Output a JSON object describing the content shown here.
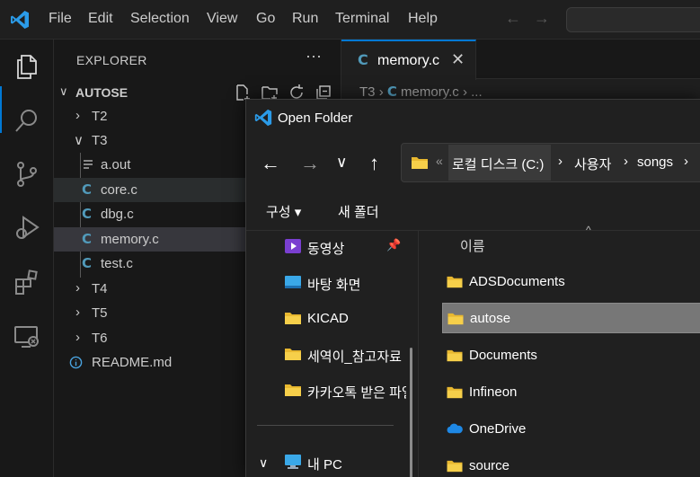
{
  "menu": [
    "File",
    "Edit",
    "Selection",
    "View",
    "Go",
    "Run",
    "Terminal",
    "Help"
  ],
  "colors": {
    "accent": "#0078d4",
    "c_icon": "#519aba",
    "folder": "#f0c040"
  },
  "explorer": {
    "title": "EXPLORER",
    "folder": "AUTOSE",
    "items": [
      {
        "label": "T2",
        "type": "folder",
        "expanded": false
      },
      {
        "label": "T3",
        "type": "folder",
        "expanded": true
      },
      {
        "label": "a.out",
        "type": "file",
        "icon": "lines-icon"
      },
      {
        "label": "core.c",
        "type": "c-file",
        "icon": "C"
      },
      {
        "label": "dbg.c",
        "type": "c-file",
        "icon": "C"
      },
      {
        "label": "memory.c",
        "type": "c-file",
        "icon": "C"
      },
      {
        "label": "test.c",
        "type": "c-file",
        "icon": "C"
      },
      {
        "label": "T4",
        "type": "folder",
        "expanded": false
      },
      {
        "label": "T5",
        "type": "folder",
        "expanded": false
      },
      {
        "label": "T6",
        "type": "folder",
        "expanded": false
      },
      {
        "label": "README.md",
        "type": "file",
        "icon": "info-icon"
      }
    ]
  },
  "editor": {
    "tab_icon": "C",
    "tab_label": "memory.c",
    "breadcrumb": {
      "folder": "T3",
      "icon": "C",
      "file": "memory.c",
      "rest": "..."
    }
  },
  "dialog": {
    "title": "Open Folder",
    "address": {
      "overflow": "«",
      "crumbs": [
        "로컬 디스크 (C:)",
        "사용자",
        "songs"
      ]
    },
    "organize": "구성 ▾",
    "new_folder": "새 폴더",
    "nav_items": [
      {
        "label": "동영상",
        "icon": "video-icon",
        "pinned": true
      },
      {
        "label": "바탕 화면",
        "icon": "desktop-icon"
      },
      {
        "label": "KICAD",
        "icon": "folder-icon"
      },
      {
        "label": "세역이_참고자료",
        "icon": "folder-icon"
      },
      {
        "label": "카카오톡 받은 파일",
        "icon": "folder-icon"
      },
      {
        "label": "내 PC",
        "icon": "pc-icon"
      }
    ],
    "column_header": "이름",
    "files": [
      {
        "label": "ADSDocuments",
        "icon": "folder-icon"
      },
      {
        "label": "autose",
        "icon": "folder-icon",
        "selected": true
      },
      {
        "label": "Documents",
        "icon": "folder-icon"
      },
      {
        "label": "Infineon",
        "icon": "folder-icon"
      },
      {
        "label": "OneDrive",
        "icon": "cloud-icon"
      },
      {
        "label": "source",
        "icon": "folder-icon"
      }
    ]
  }
}
